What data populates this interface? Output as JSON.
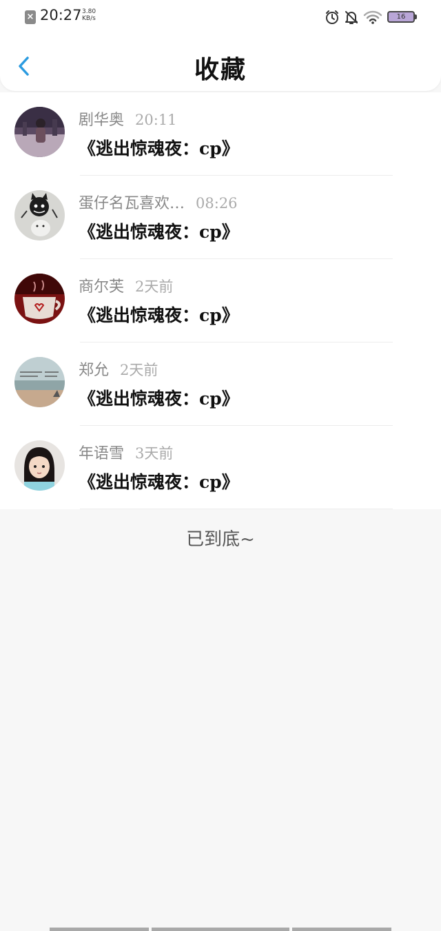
{
  "status_bar": {
    "close_glyph": "×",
    "time": "20:27",
    "speed_value": "3.80",
    "speed_unit": "KB/s",
    "battery": "16",
    "icons": [
      "alarm-icon",
      "bell-muted-icon",
      "wifi-icon",
      "battery-icon"
    ]
  },
  "header": {
    "back_icon": "chevron-left-icon",
    "title": "收藏",
    "accent": "#2b9be0"
  },
  "favorites": [
    {
      "name": "剧华奥",
      "time": "20:11",
      "title": "《逃出惊魂夜：cp》",
      "avatar": "avatar-photo-street"
    },
    {
      "name": "蛋仔名瓦喜欢…",
      "time": "08:26",
      "title": "《逃出惊魂夜：cp》",
      "avatar": "avatar-photo-cat"
    },
    {
      "name": "商尔芙",
      "time": "2天前",
      "title": "《逃出惊魂夜：cp》",
      "avatar": "avatar-photo-cup"
    },
    {
      "name": "郑允",
      "time": "2天前",
      "title": "《逃出惊魂夜：cp》",
      "avatar": "avatar-photo-beach"
    },
    {
      "name": "年语雪",
      "time": "3天前",
      "title": "《逃出惊魂夜：cp》",
      "avatar": "avatar-photo-girl"
    }
  ],
  "end_text": "已到底~"
}
